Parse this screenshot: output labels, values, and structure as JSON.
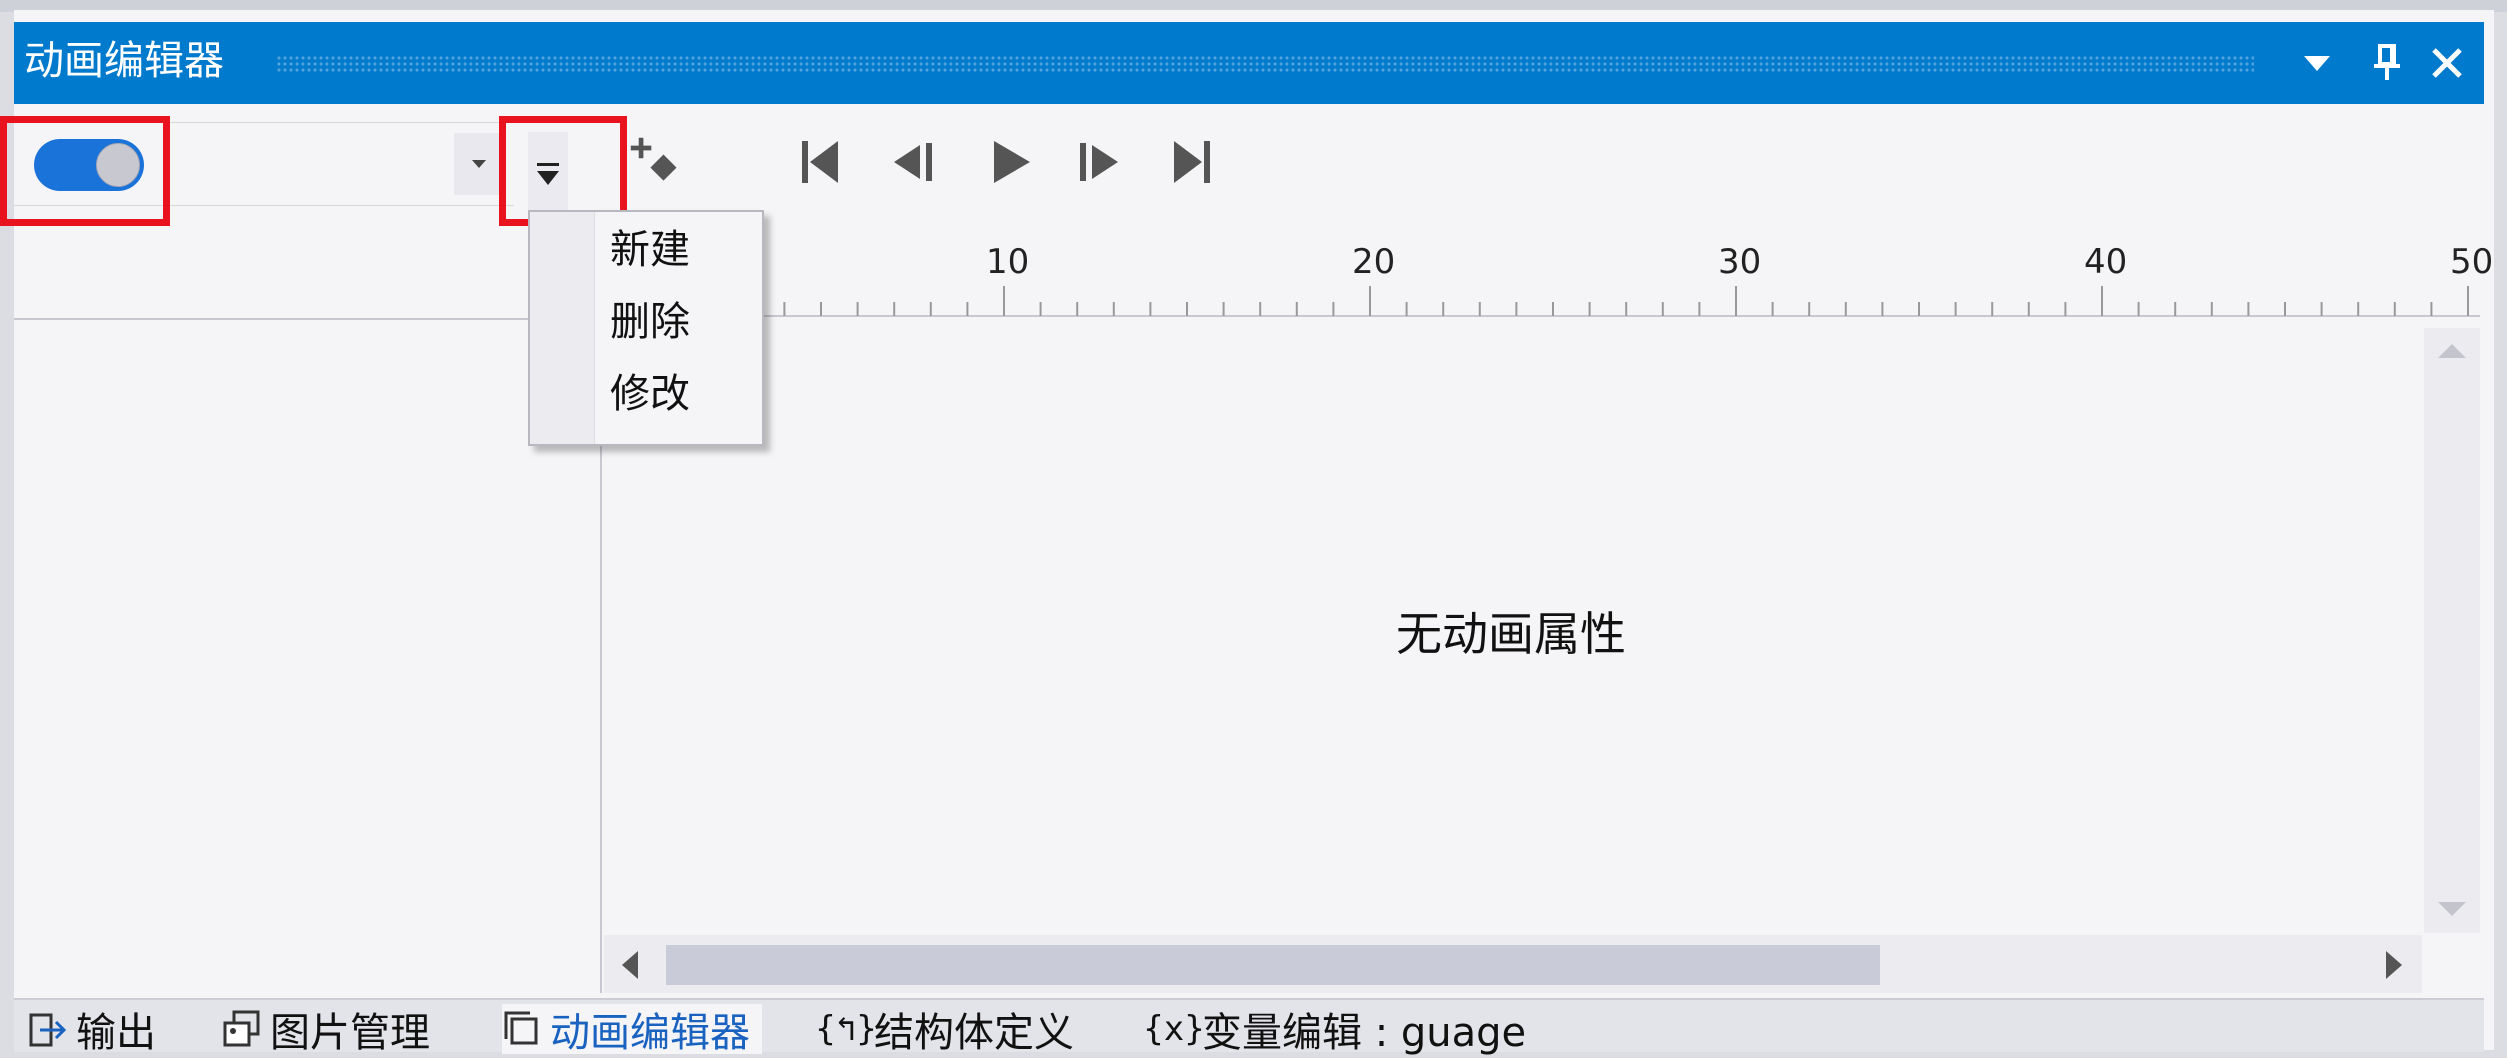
{
  "window": {
    "title": "动画编辑器",
    "accent_color": "#007acc",
    "buttons": [
      {
        "name": "dropdown-icon"
      },
      {
        "name": "pin-icon"
      },
      {
        "name": "close-icon"
      }
    ]
  },
  "toolbar": {
    "toggle_on": true,
    "animation_combo_value": "",
    "playback_buttons": [
      "add-keyframe-icon",
      "skip-to-start-icon",
      "step-back-icon",
      "play-icon",
      "step-forward-icon",
      "skip-to-end-icon"
    ]
  },
  "dropdown_menu": {
    "items": [
      "新建",
      "删除",
      "修改"
    ]
  },
  "timeline": {
    "ruler_labels": [
      "10",
      "20",
      "30",
      "40",
      "50"
    ]
  },
  "content": {
    "empty_message": "无动画属性"
  },
  "bottom_tabs": [
    {
      "label": "输出",
      "icon": "output-icon",
      "active": false
    },
    {
      "label": "图片管理",
      "icon": "image-manager-icon",
      "active": false
    },
    {
      "label": "动画编辑器",
      "icon": "animation-editor-icon",
      "active": true
    },
    {
      "label": "结构体定义",
      "icon": "struct-icon",
      "active": false
    },
    {
      "label": "变量编辑 : guage",
      "icon": "variable-icon",
      "active": false
    }
  ],
  "highlight_color": "#e8131f"
}
